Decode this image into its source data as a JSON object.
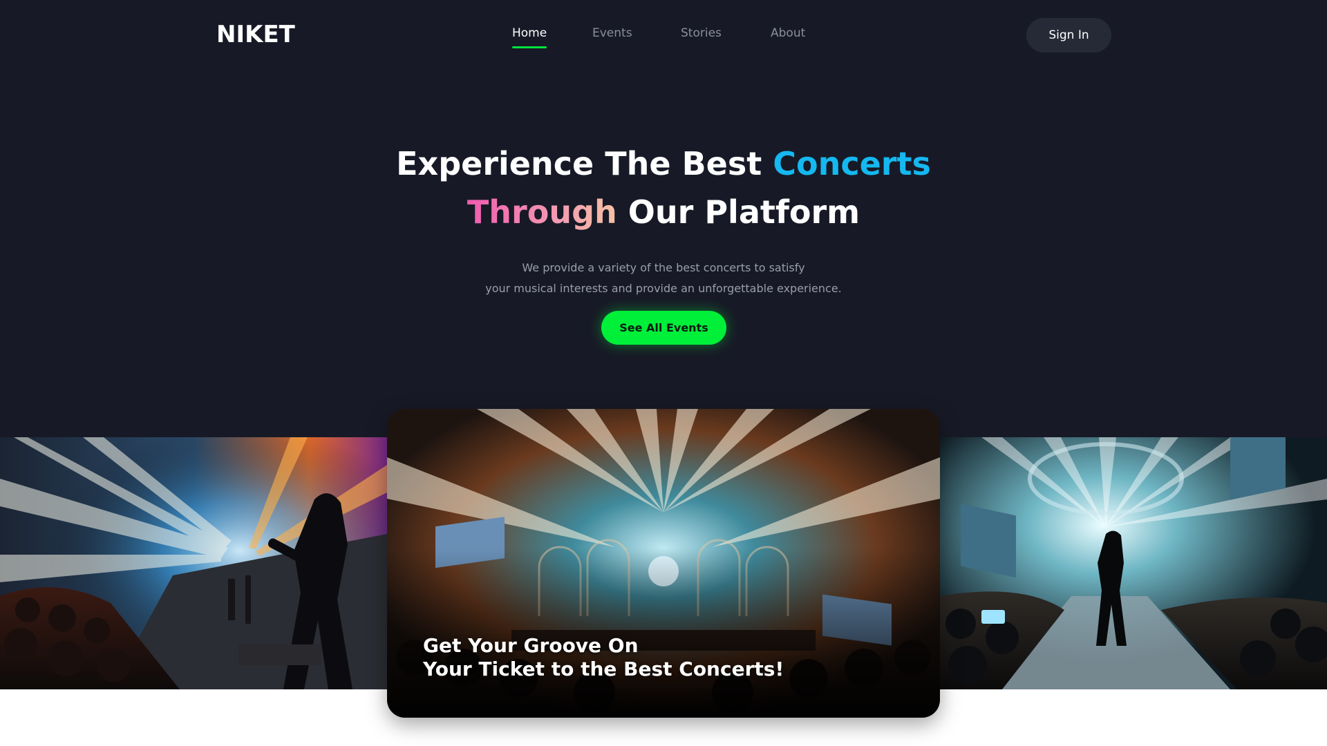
{
  "brand": {
    "logo_text": "NIKET"
  },
  "nav": {
    "items": [
      {
        "label": "Home",
        "active": true
      },
      {
        "label": "Events",
        "active": false
      },
      {
        "label": "Stories",
        "active": false
      },
      {
        "label": "About",
        "active": false
      }
    ],
    "signin_label": "Sign In"
  },
  "hero": {
    "line1_plain": "Experience The Best ",
    "line1_accent": "Concerts",
    "line2_accent": "Through",
    "line2_plain": " Our Platform",
    "subtitle_line1": "We provide a variety of the best concerts to satisfy",
    "subtitle_line2": "your musical interests and provide an unforgettable experience.",
    "cta_label": "See All Events"
  },
  "gallery": {
    "featured_caption_line1": "Get Your Groove On",
    "featured_caption_line2": "Your Ticket to the Best Concerts!"
  },
  "colors": {
    "background": "#171a26",
    "accent_green": "#00f03a",
    "accent_blue": "#15b8f0",
    "accent_pink": "#f05bb0",
    "signin_bg": "#262a37"
  }
}
